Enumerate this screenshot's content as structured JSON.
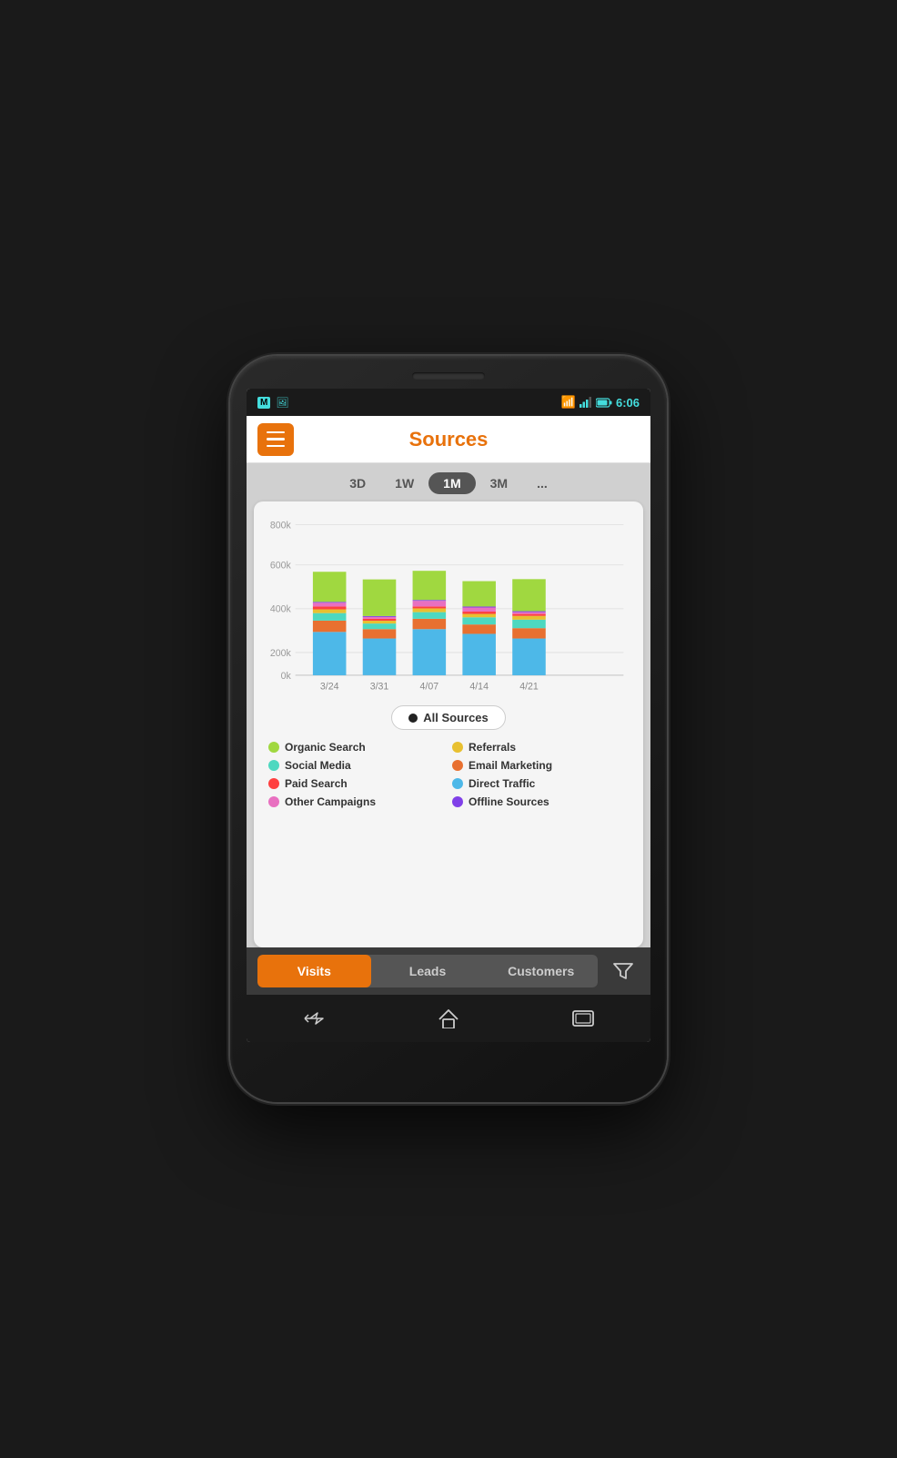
{
  "statusBar": {
    "time": "6:06",
    "icons": [
      "gmail",
      "image",
      "wifi",
      "signal",
      "battery"
    ]
  },
  "header": {
    "menuLabel": "menu",
    "title": "Sources"
  },
  "timeTabs": [
    {
      "label": "3D",
      "active": false
    },
    {
      "label": "1W",
      "active": false
    },
    {
      "label": "1M",
      "active": true
    },
    {
      "label": "3M",
      "active": false
    },
    {
      "label": "...",
      "active": false
    }
  ],
  "chart": {
    "yLabels": [
      "800k",
      "600k",
      "400k",
      "200k",
      "0k"
    ],
    "xLabels": [
      "3/24",
      "3/31",
      "4/07",
      "4/14",
      "4/21"
    ],
    "bars": [
      {
        "label": "3/24",
        "segments": [
          {
            "color": "#4db8e8",
            "value": 230
          },
          {
            "color": "#e87030",
            "value": 60
          },
          {
            "color": "#4dd8c0",
            "value": 40
          },
          {
            "color": "#e8c030",
            "value": 20
          },
          {
            "color": "#ff4040",
            "value": 15
          },
          {
            "color": "#e870c0",
            "value": 20
          },
          {
            "color": "#8040e8",
            "value": 5
          },
          {
            "color": "#a0d840",
            "value": 160
          }
        ],
        "total": 570
      },
      {
        "label": "3/31",
        "segments": [
          {
            "color": "#4db8e8",
            "value": 195
          },
          {
            "color": "#e87030",
            "value": 50
          },
          {
            "color": "#4dd8c0",
            "value": 30
          },
          {
            "color": "#e8c030",
            "value": 15
          },
          {
            "color": "#ff4040",
            "value": 10
          },
          {
            "color": "#e870c0",
            "value": 10
          },
          {
            "color": "#8040e8",
            "value": 5
          },
          {
            "color": "#a0d840",
            "value": 195
          }
        ],
        "total": 500
      },
      {
        "label": "4/07",
        "segments": [
          {
            "color": "#4db8e8",
            "value": 245
          },
          {
            "color": "#e87030",
            "value": 55
          },
          {
            "color": "#4dd8c0",
            "value": 35
          },
          {
            "color": "#e8c030",
            "value": 20
          },
          {
            "color": "#ff4040",
            "value": 10
          },
          {
            "color": "#e870c0",
            "value": 30
          },
          {
            "color": "#8040e8",
            "value": 5
          },
          {
            "color": "#a0d840",
            "value": 155
          }
        ],
        "total": 540
      },
      {
        "label": "4/14",
        "segments": [
          {
            "color": "#4db8e8",
            "value": 220
          },
          {
            "color": "#e87030",
            "value": 50
          },
          {
            "color": "#4dd8c0",
            "value": 38
          },
          {
            "color": "#e8c030",
            "value": 18
          },
          {
            "color": "#ff4040",
            "value": 12
          },
          {
            "color": "#e870c0",
            "value": 22
          },
          {
            "color": "#8040e8",
            "value": 5
          },
          {
            "color": "#a0d840",
            "value": 135
          }
        ],
        "total": 490
      },
      {
        "label": "4/21",
        "segments": [
          {
            "color": "#4db8e8",
            "value": 195
          },
          {
            "color": "#e87030",
            "value": 55
          },
          {
            "color": "#4dd8c0",
            "value": 45
          },
          {
            "color": "#e8c030",
            "value": 20
          },
          {
            "color": "#ff4040",
            "value": 10
          },
          {
            "color": "#e870c0",
            "value": 10
          },
          {
            "color": "#8040e8",
            "value": 5
          },
          {
            "color": "#a0d840",
            "value": 170
          }
        ],
        "total": 510
      }
    ]
  },
  "allSourcesBtn": "All Sources",
  "legend": [
    {
      "label": "Organic Search",
      "color": "#a0d840"
    },
    {
      "label": "Referrals",
      "color": "#e8c030"
    },
    {
      "label": "Social Media",
      "color": "#4dd8c0"
    },
    {
      "label": "Email Marketing",
      "color": "#e87030"
    },
    {
      "label": "Paid Search",
      "color": "#ff4040"
    },
    {
      "label": "Direct Traffic",
      "color": "#4db8e8"
    },
    {
      "label": "Other Campaigns",
      "color": "#e870c0"
    },
    {
      "label": "Offline Sources",
      "color": "#8040e8"
    }
  ],
  "bottomTabs": [
    {
      "label": "Visits",
      "active": true
    },
    {
      "label": "Leads",
      "active": false
    },
    {
      "label": "Customers",
      "active": false
    }
  ],
  "navButtons": [
    "←",
    "⌂",
    "▭"
  ]
}
